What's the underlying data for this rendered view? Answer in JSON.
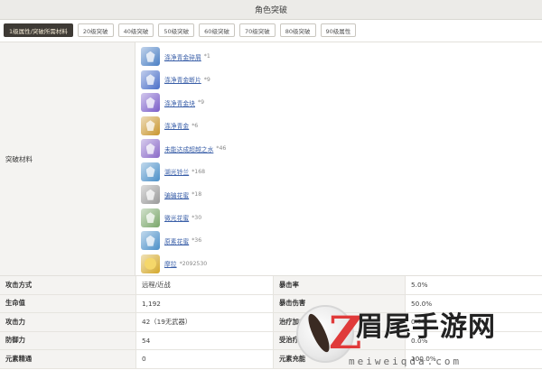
{
  "title": "角色突破",
  "tabs": [
    {
      "label": "1级属性/突破所需材料",
      "active": true
    },
    {
      "label": "20级突破"
    },
    {
      "label": "40级突破"
    },
    {
      "label": "50级突破"
    },
    {
      "label": "60级突破"
    },
    {
      "label": "70级突破"
    },
    {
      "label": "80级突破"
    },
    {
      "label": "90级属性"
    }
  ],
  "materials_label": "突破材料",
  "materials": [
    {
      "name": "涤净青金碎屑",
      "count": "*1",
      "icon": "blue-gem-icon",
      "color": "#4a7fc4"
    },
    {
      "name": "涤净青金断片",
      "count": "*9",
      "icon": "blue-gem-icon",
      "color": "#4a6fc8"
    },
    {
      "name": "涤净青金块",
      "count": "*9",
      "icon": "purple-gem-icon",
      "color": "#7a5cc8"
    },
    {
      "name": "涤净青金",
      "count": "*6",
      "icon": "gold-gem-icon",
      "color": "#c9962f"
    },
    {
      "name": "未能达成超越之水",
      "count": "*46",
      "icon": "water-orb-icon",
      "color": "#8a6ac8"
    },
    {
      "name": "湖光铃兰",
      "count": "*168",
      "icon": "flower-icon",
      "color": "#4a8fc8"
    },
    {
      "name": "骗骗花蜜",
      "count": "*18",
      "icon": "nectar-icon",
      "color": "#9a9a9a"
    },
    {
      "name": "微光花蜜",
      "count": "*30",
      "icon": "nectar-icon",
      "color": "#7aa66a"
    },
    {
      "name": "原素花蜜",
      "count": "*36",
      "icon": "nectar-icon",
      "color": "#4a8fc8"
    },
    {
      "name": "摩拉",
      "count": "*2092530",
      "icon": "mora-coin-icon",
      "color": "#d4a82a"
    }
  ],
  "stats": [
    {
      "k": "攻击方式",
      "v": "远程/近战",
      "k2": "暴击率",
      "v2": "5.0%"
    },
    {
      "k": "生命值",
      "v": "1,192",
      "k2": "暴击伤害",
      "v2": "50.0%"
    },
    {
      "k": "攻击力",
      "v": "42（19无武器）",
      "k2": "治疗加成",
      "v2": "0.0%"
    },
    {
      "k": "防御力",
      "v": "54",
      "k2": "受治疗加成",
      "v2": "0.0%"
    },
    {
      "k": "元素精通",
      "v": "0",
      "k2": "元素充能",
      "v2": "100.0%"
    }
  ],
  "watermark": {
    "brand": "眉尾手游网",
    "url": "meiweiqda.com"
  }
}
